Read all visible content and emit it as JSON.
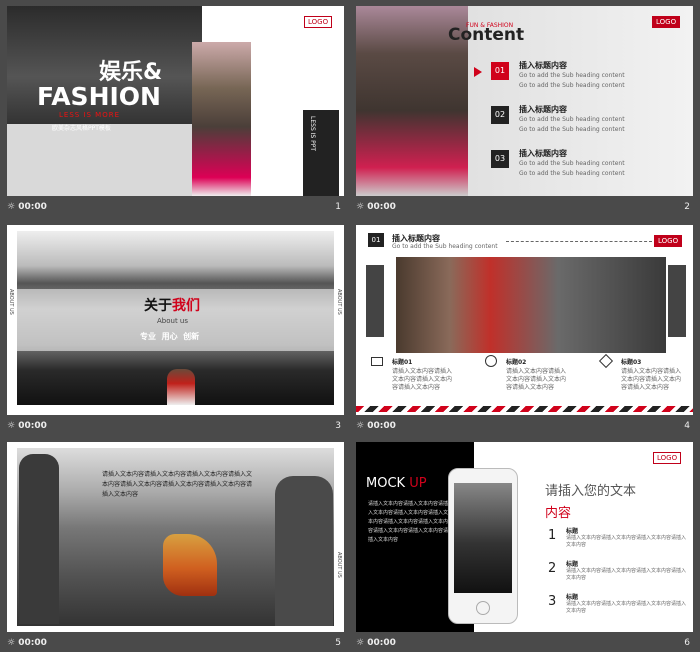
{
  "logo": "LOGO",
  "slides": [
    {
      "num": "1",
      "time": "00:00",
      "title_cn": "娱乐&",
      "title_en": "FASHION",
      "tagline": "LESS IS MORE",
      "sub": "欧美杂志风格PPT模板",
      "side": "LESS IS PPT"
    },
    {
      "num": "2",
      "time": "00:00",
      "kicker": "FUN & FASHION",
      "title": "Content",
      "items": [
        {
          "n": "01",
          "title": "插入标题内容",
          "l1": "Go to add the Sub heading content",
          "l2": "Go to add the Sub heading content"
        },
        {
          "n": "02",
          "title": "插入标题内容",
          "l1": "Go to add the Sub heading content",
          "l2": "Go to add the Sub heading content"
        },
        {
          "n": "03",
          "title": "插入标题内容",
          "l1": "Go to add the Sub heading content",
          "l2": "Go to add the Sub heading content"
        }
      ]
    },
    {
      "num": "3",
      "time": "00:00",
      "t1": "关于",
      "t2": "我们",
      "sub": "About us",
      "tags": "专业  用心  创新",
      "side": "ABOUT US"
    },
    {
      "num": "4",
      "time": "00:00",
      "badge": "01",
      "title": "插入标题内容",
      "sub": "Go to add the Sub heading content",
      "cols": [
        {
          "label": "标题01",
          "text": "请插入文本内容请插入文本内容请插入文本内容请插入文本内容"
        },
        {
          "label": "标题02",
          "text": "请插入文本内容请插入文本内容请插入文本内容请插入文本内容"
        },
        {
          "label": "标题03",
          "text": "请插入文本内容请插入文本内容请插入文本内容请插入文本内容"
        }
      ]
    },
    {
      "num": "5",
      "time": "00:00",
      "text": "请插入文本内容请插入文本内容请插入文本内容请插入文本内容请插入文本内容请插入文本内容请插入文本内容请插入文本内容",
      "side": "ABOUT US"
    },
    {
      "num": "6",
      "time": "00:00",
      "mock": "MOCK",
      "up": "UP",
      "heading": "请插入您的文本",
      "heading_red": "内容",
      "left_text": "请插入文本内容请插入文本内容请插入文本内容请插入文本内容请插入文本内容请插入文本内容请插入文本内容请插入文本内容请插入文本内容请插入文本内容",
      "items": [
        {
          "n": "1",
          "label": "标题",
          "text": "请插入文本内容请插入文本内容请插入文本内容请插入文本内容"
        },
        {
          "n": "2",
          "label": "标题",
          "text": "请插入文本内容请插入文本内容请插入文本内容请插入文本内容"
        },
        {
          "n": "3",
          "label": "标题",
          "text": "请插入文本内容请插入文本内容请插入文本内容请插入文本内容"
        }
      ]
    }
  ],
  "colors": {
    "accent": "#d0021b",
    "bg": "#4a4a4a"
  }
}
